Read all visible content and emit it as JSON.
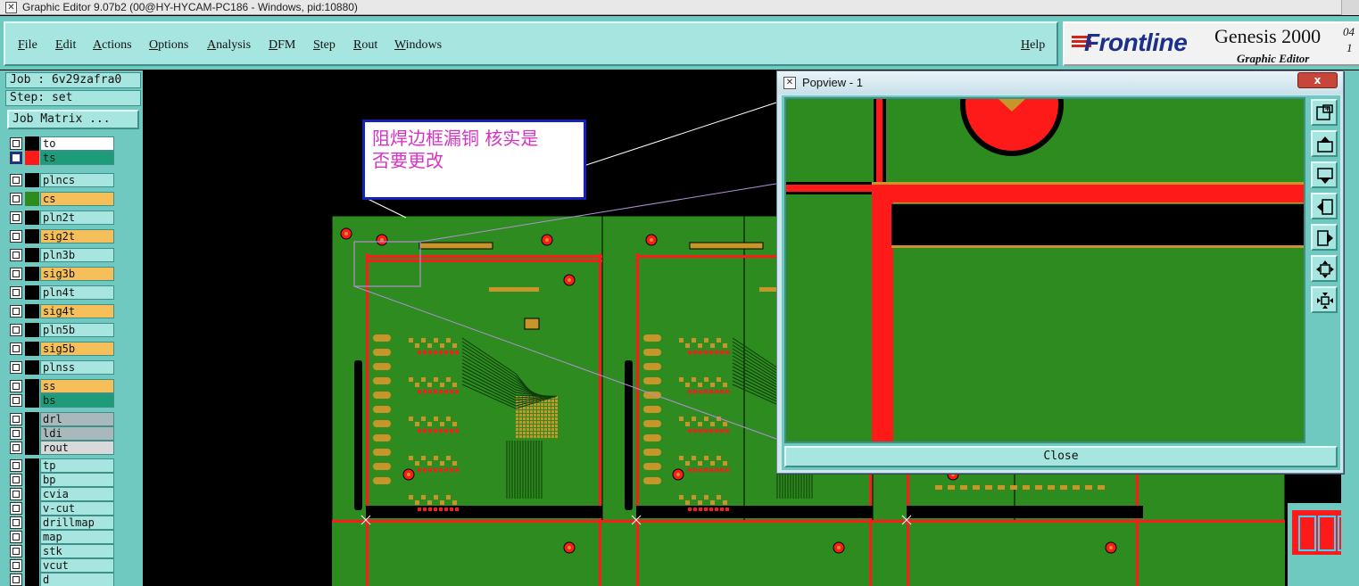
{
  "window": {
    "title": "Graphic Editor 9.07b2 (00@HY-HYCAM-PC186 - Windows, pid:10880)",
    "app_icon": "x-close-icon"
  },
  "menu": {
    "items": [
      "File",
      "Edit",
      "Actions",
      "Options",
      "Analysis",
      "DFM",
      "Step",
      "Rout",
      "Windows"
    ],
    "help": "Help"
  },
  "brand": {
    "logo": "Frontline",
    "product": "Genesis 2000",
    "version_sup": "04",
    "version_sub": "1",
    "subtitle": "Graphic Editor"
  },
  "job": {
    "job_line": "Job : 6v29zafra0",
    "step_line": "Step: set",
    "matrix_button": "Job Matrix ..."
  },
  "layer_groups": [
    [
      {
        "name": "to",
        "checked": false,
        "swatch": "#000000",
        "bg": "#ffffff"
      },
      {
        "name": "ts",
        "checked": true,
        "swatch": "#ff1a1a",
        "bg": "#1e9c7a"
      }
    ],
    [
      {
        "name": "plncs",
        "checked": false,
        "swatch": "#000000",
        "bg": "#a7e6e0"
      },
      {
        "name": "cs",
        "checked": false,
        "swatch": "#2e8b1f",
        "bg": "#f5c05a"
      },
      {
        "name": "pln2t",
        "checked": false,
        "swatch": "#000000",
        "bg": "#a7e6e0"
      },
      {
        "name": "sig2t",
        "checked": false,
        "swatch": "#000000",
        "bg": "#f5c05a"
      },
      {
        "name": "pln3b",
        "checked": false,
        "swatch": "#000000",
        "bg": "#a7e6e0"
      },
      {
        "name": "sig3b",
        "checked": false,
        "swatch": "#000000",
        "bg": "#f5c05a"
      },
      {
        "name": "pln4t",
        "checked": false,
        "swatch": "#000000",
        "bg": "#a7e6e0"
      },
      {
        "name": "sig4t",
        "checked": false,
        "swatch": "#000000",
        "bg": "#f5c05a"
      },
      {
        "name": "pln5b",
        "checked": false,
        "swatch": "#000000",
        "bg": "#a7e6e0"
      },
      {
        "name": "sig5b",
        "checked": false,
        "swatch": "#000000",
        "bg": "#f5c05a"
      },
      {
        "name": "plnss",
        "checked": false,
        "swatch": "#000000",
        "bg": "#a7e6e0"
      }
    ],
    [
      {
        "name": "ss",
        "checked": false,
        "swatch": "#000000",
        "bg": "#f5c05a"
      },
      {
        "name": "bs",
        "checked": false,
        "swatch": "#000000",
        "bg": "#1e9c7a"
      }
    ],
    [
      {
        "name": "drl",
        "checked": false,
        "swatch": "#000000",
        "bg": "#a9b9bb"
      },
      {
        "name": "ldi",
        "checked": false,
        "swatch": "#000000",
        "bg": "#a9b9bb"
      },
      {
        "name": "rout",
        "checked": false,
        "swatch": "#000000",
        "bg": "#d9d9d9"
      }
    ],
    [
      {
        "name": "tp",
        "checked": false,
        "swatch": "#000000",
        "bg": "#a7e6e0"
      },
      {
        "name": "bp",
        "checked": false,
        "swatch": "#000000",
        "bg": "#a7e6e0"
      },
      {
        "name": "cvia",
        "checked": false,
        "swatch": "#000000",
        "bg": "#a7e6e0"
      },
      {
        "name": "v-cut",
        "checked": false,
        "swatch": "#000000",
        "bg": "#a7e6e0"
      },
      {
        "name": "drillmap",
        "checked": false,
        "swatch": "#000000",
        "bg": "#a7e6e0"
      },
      {
        "name": "map",
        "checked": false,
        "swatch": "#000000",
        "bg": "#a7e6e0"
      },
      {
        "name": "stk",
        "checked": false,
        "swatch": "#000000",
        "bg": "#a7e6e0"
      },
      {
        "name": "vcut",
        "checked": false,
        "swatch": "#000000",
        "bg": "#a7e6e0"
      },
      {
        "name": "d",
        "checked": false,
        "swatch": "#000000",
        "bg": "#a7e6e0"
      }
    ]
  ],
  "annotation": {
    "line1": "阻焊边框漏铜 核实是",
    "line2": "否要更改"
  },
  "popview": {
    "title": "Popview - 1",
    "close_x": "x",
    "close_button": "Close",
    "tools": [
      "zoom-window-icon",
      "pan-up-icon",
      "pan-down-icon",
      "pan-left-icon",
      "pan-right-icon",
      "zoom-in-icon",
      "zoom-out-icon"
    ]
  },
  "colors": {
    "panel": "#6fc9c0",
    "panel_light": "#a7e6e0",
    "board_green": "#2e8b1f",
    "copper_red": "#ff1a1a",
    "pad_orange": "#c8952a",
    "annotation_text": "#d633c4",
    "annotation_border": "#1420b8"
  }
}
